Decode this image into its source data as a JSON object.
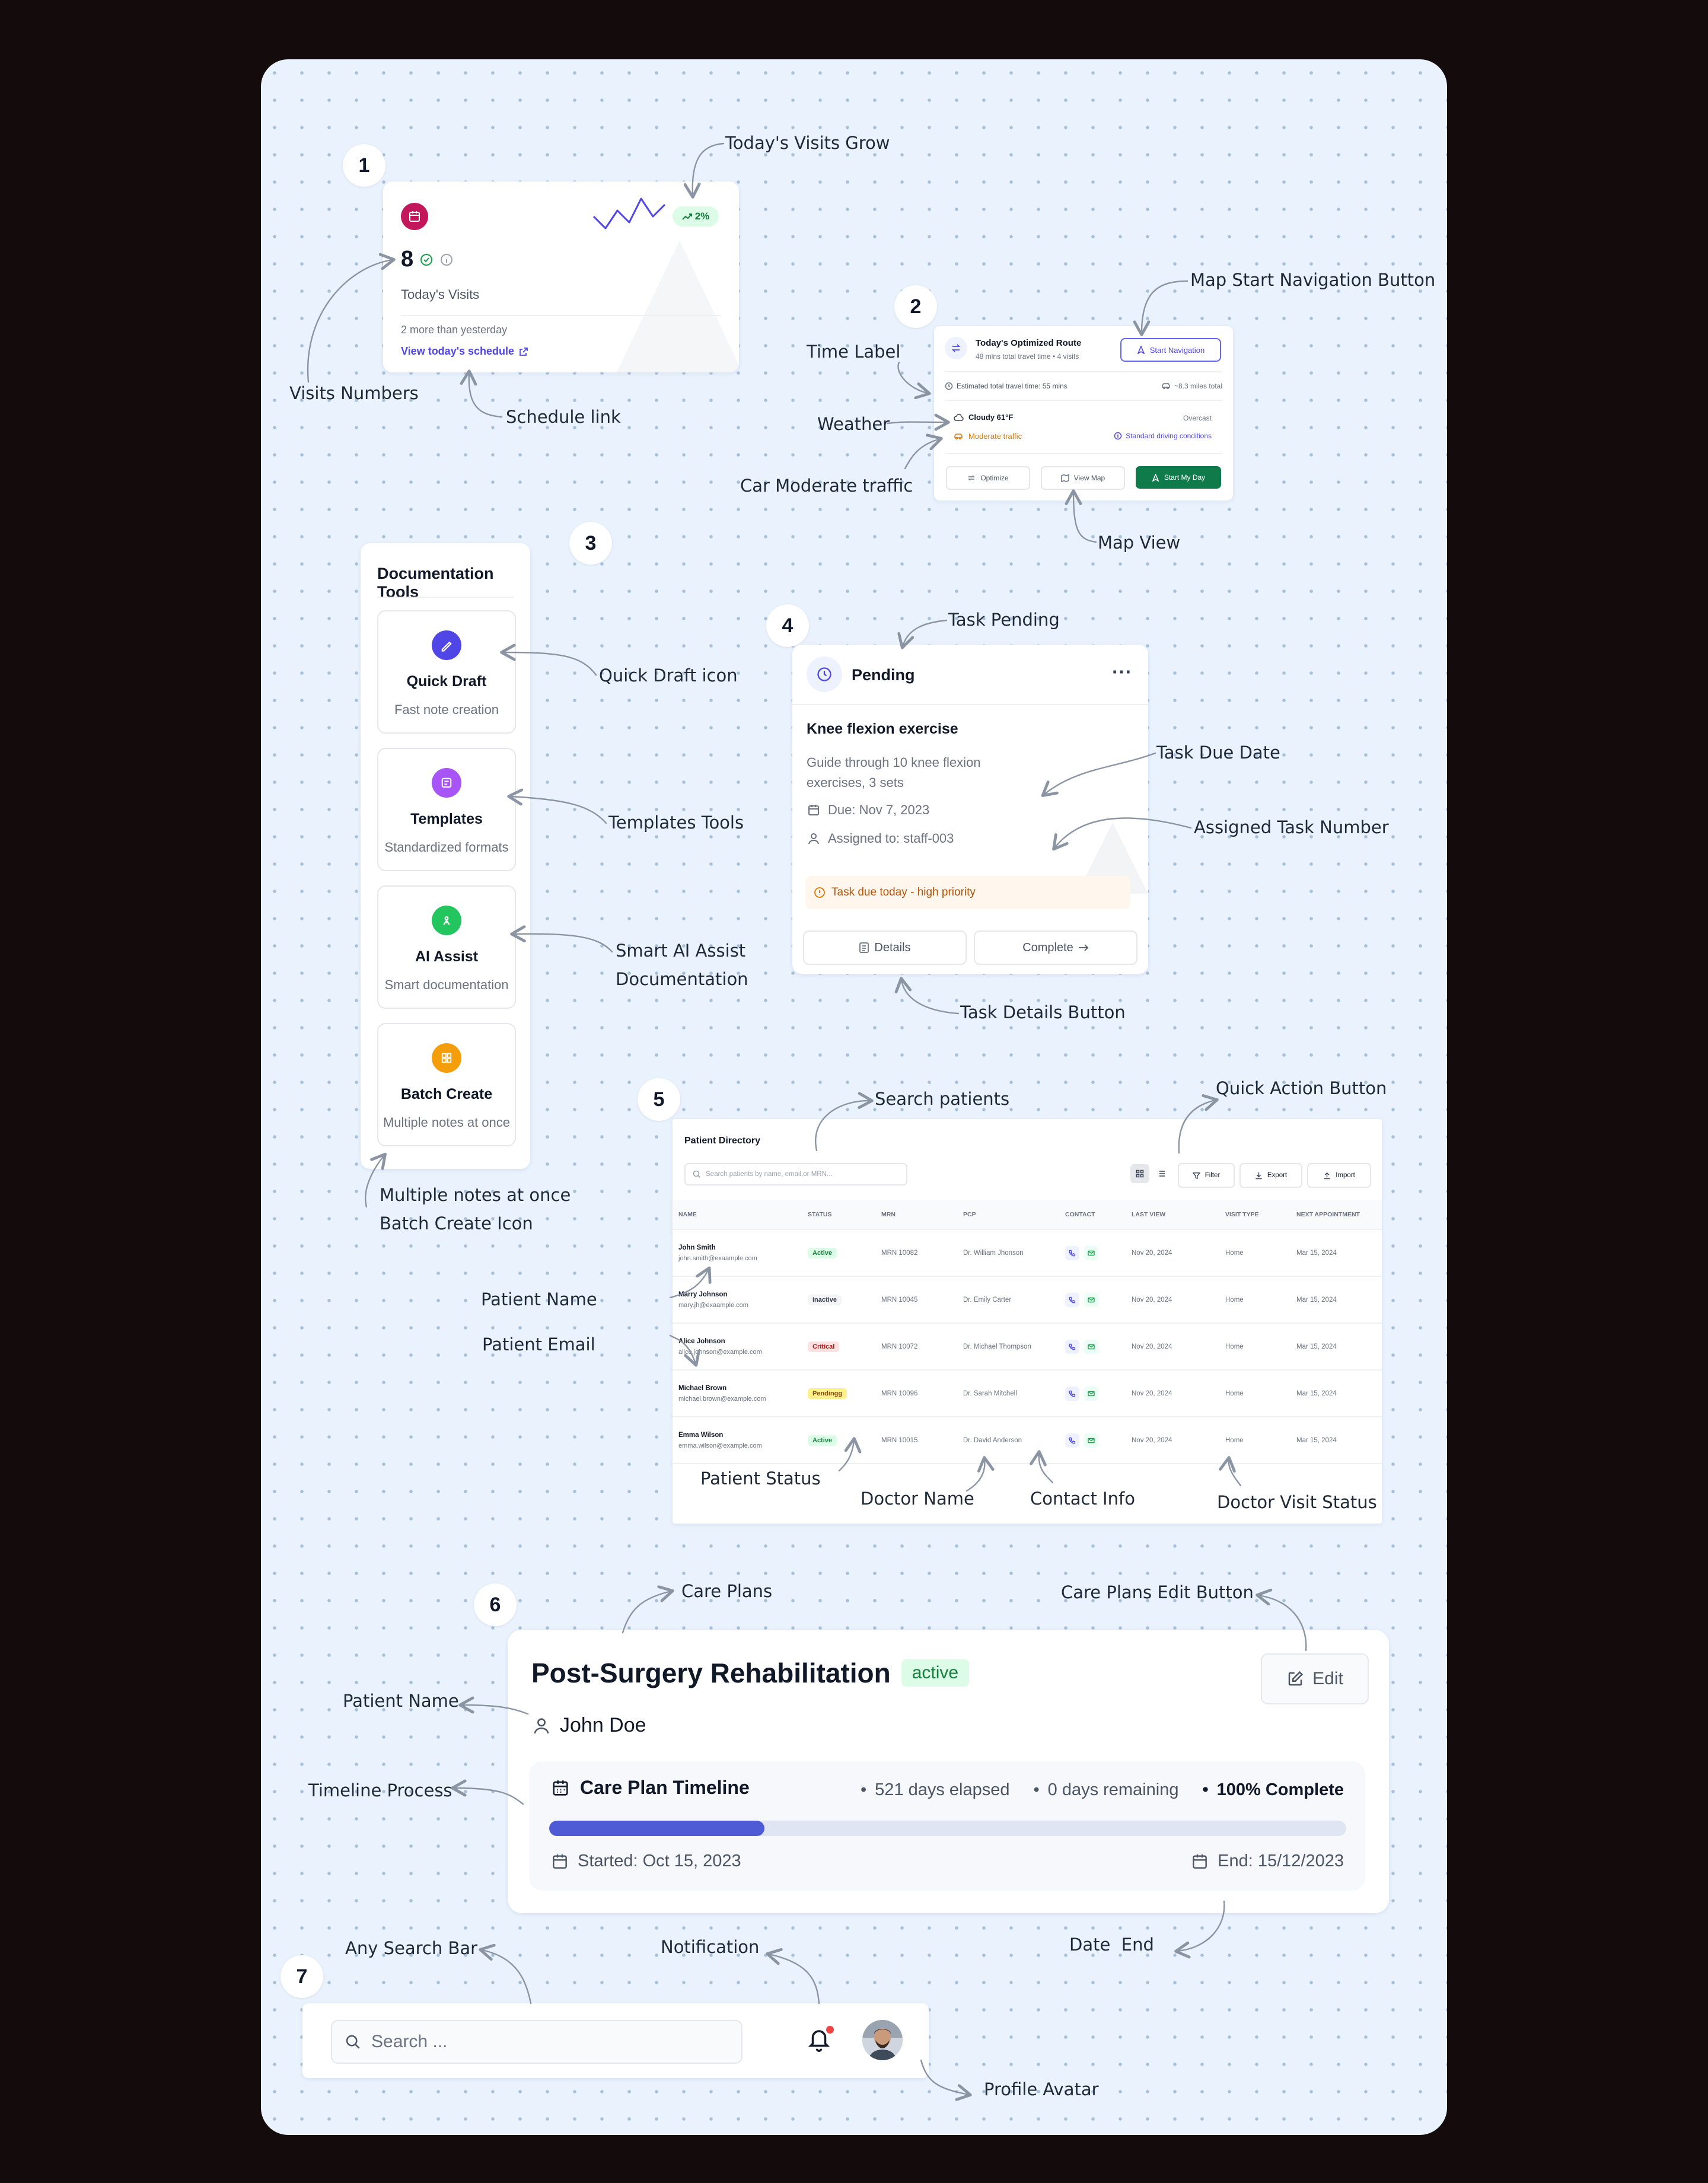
{
  "steps": [
    "1",
    "2",
    "3",
    "4",
    "5",
    "6",
    "7"
  ],
  "annotations": {
    "visits_grow": "Today's Visits Grow",
    "visits_numbers": "Visits Numbers",
    "schedule_link": "Schedule link",
    "map_start_nav": "Map Start Navigation Button",
    "time_label": "Time Label",
    "weather": "Weather",
    "car_traffic": "Car Moderate traffic",
    "map_view": "Map View",
    "quick_draft_icon": "Quick Draft icon",
    "templates_tools": "Templates Tools",
    "smart_ai_1": "Smart AI Assist",
    "smart_ai_2": "Documentation",
    "multiple_notes_1": "Multiple notes at once",
    "multiple_notes_2": "Batch Create Icon",
    "task_pending": "Task Pending",
    "task_due_date": "Task Due Date",
    "assigned_task_number": "Assigned Task Number",
    "task_details_button": "Task Details Button",
    "search_patients": "Search patients",
    "quick_action_button": "Quick Action Button",
    "patient_name": "Patient Name",
    "patient_email": "Patient Email",
    "patient_status": "Patient Status",
    "doctor_name": "Doctor Name",
    "contact_info": "Contact Info",
    "doctor_visit_status": "Doctor Visit Status",
    "care_plans": "Care Plans",
    "care_plans_edit": "Care Plans Edit Button",
    "patient_name_2": "Patient Name",
    "timeline_process": "Timeline Process",
    "date_end": "Date  End",
    "any_search_bar": "Any Search Bar",
    "notification": "Notification",
    "profile_avatar": "Profile Avatar"
  },
  "visits_card": {
    "growth": "2%",
    "count": "8",
    "label": "Today's Visits",
    "compare": "2 more than yesterday",
    "link": "View today's schedule",
    "sparkline": [
      3,
      1,
      4,
      2,
      6,
      3,
      5
    ],
    "colors": {
      "icon_bg": "#c2185b",
      "line": "#4f46e5",
      "growth_bg": "#dcfce7",
      "growth_text": "#15803d"
    }
  },
  "route_card": {
    "title": "Today's Optimized Route",
    "subtitle": "48 mins total travel time • 4 visits",
    "start_nav": "Start Navigation",
    "travel_time": "Estimated total travel time: 55 mins",
    "miles": "~8.3 miles total",
    "weather": "Cloudy 61°F",
    "overcast": "Overcast",
    "traffic": "Moderate traffic",
    "driving": "Standard driving conditions",
    "optimize": "Optimize",
    "view_map": "View Map",
    "start_day": "Start My Day",
    "colors": {
      "primary": "#0f7a4a",
      "traffic": "#d97706",
      "link": "#4f46e5"
    }
  },
  "doc_tools": {
    "title": "Documentation Tools",
    "items": [
      {
        "title": "Quick Draft",
        "subtitle": "Fast note creation",
        "icon": "pencil-icon",
        "color": "#4f46e5"
      },
      {
        "title": "Templates",
        "subtitle": "Standardized formats",
        "icon": "template-icon",
        "color": "#a855f7"
      },
      {
        "title": "AI Assist",
        "subtitle": "Smart documentation",
        "icon": "ai-icon",
        "color": "#22c55e"
      },
      {
        "title": "Batch Create",
        "subtitle": "Multiple notes at once",
        "icon": "grid-icon",
        "color": "#f59e0b"
      }
    ]
  },
  "task_card": {
    "status": "Pending",
    "title": "Knee flexion exercise",
    "desc_1": "Guide through 10 knee flexion",
    "desc_2": "exercises, 3 sets",
    "due": "Due: Nov 7, 2023",
    "assigned": "Assigned to: staff-003",
    "alert": "Task due today - high priority",
    "details": "Details",
    "complete": "Complete"
  },
  "patients": {
    "title": "Patient Directory",
    "search_placeholder": "Search patients by name, email,or MRN...",
    "filter": "Filter",
    "export": "Export",
    "import": "Import",
    "columns": [
      "NAME",
      "STATUS",
      "MRN",
      "PCP",
      "CONTACT",
      "LAST VIEW",
      "VISIT TYPE",
      "NEXT APPOINTMENT"
    ],
    "rows": [
      {
        "name": "John Smith",
        "email": "john.smith@exaample.com",
        "status": "Active",
        "mrn": "MRN 10082",
        "pcp": "Dr. William Jhonson",
        "last": "Nov 20, 2024",
        "type": "Home",
        "next": "Mar 15, 2024"
      },
      {
        "name": "Marry Johnson",
        "email": "mary.jh@exaample.com",
        "status": "Inactive",
        "mrn": "MRN 10045",
        "pcp": "Dr. Emily Carter",
        "last": "Nov 20, 2024",
        "type": "Home",
        "next": "Mar 15, 2024"
      },
      {
        "name": "Alice Johnson",
        "email": "alice.johnson@example.com",
        "status": "Critical",
        "mrn": "MRN 10072",
        "pcp": "Dr. Michael Thompson",
        "last": "Nov 20, 2024",
        "type": "Home",
        "next": "Mar 15, 2024"
      },
      {
        "name": "Michael Brown",
        "email": "michael.brown@example.com",
        "status": "Pendingg",
        "mrn": "MRN 10096",
        "pcp": "Dr. Sarah Mitchell",
        "last": "Nov 20, 2024",
        "type": "Home",
        "next": "Mar 15, 2024"
      },
      {
        "name": "Emma Wilson",
        "email": "emma.wilson@example.com",
        "status": "Active",
        "mrn": "MRN 10015",
        "pcp": "Dr. David Anderson",
        "last": "Nov 20, 2024",
        "type": "Home",
        "next": "Mar 15, 2024"
      }
    ],
    "status_colors": {
      "Active": {
        "bg": "#dcfce7",
        "fg": "#15803d"
      },
      "Inactive": {
        "bg": "#f3f4f6",
        "fg": "#374151"
      },
      "Critical": {
        "bg": "#fee2e2",
        "fg": "#b91c1c"
      },
      "Pendingg": {
        "bg": "#fef08a",
        "fg": "#854d0e"
      }
    }
  },
  "care_plan": {
    "title": "Post-Surgery Rehabilitation",
    "badge": "active",
    "edit": "Edit",
    "patient": "John Doe",
    "timeline_title": "Care Plan Timeline",
    "elapsed": "521 days elapsed",
    "remaining": "0 days remaining",
    "complete": "100% Complete",
    "progress": 0.27,
    "started": "Started: Oct 15, 2023",
    "end": "End: 15/12/2023",
    "colors": {
      "bar": "#4f5bd5",
      "track": "#dfe5f3",
      "badge_bg": "#dcfce7",
      "badge_fg": "#15803d"
    }
  },
  "topbar": {
    "search_placeholder": "Search ...",
    "notification_dot": "#ef4444"
  }
}
